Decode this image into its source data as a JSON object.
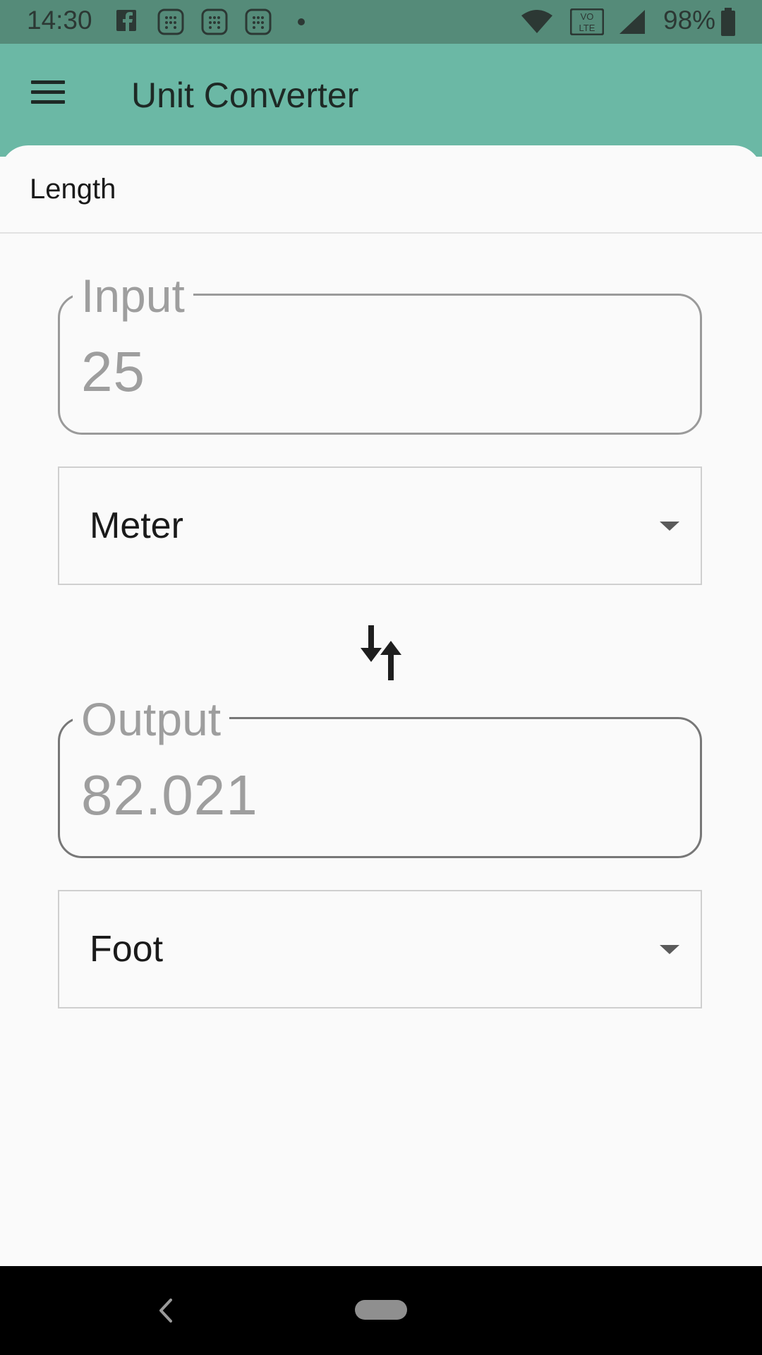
{
  "status_bar": {
    "time": "14:30",
    "battery": "98%",
    "icons": [
      "facebook-icon",
      "notification-icon",
      "notification-icon",
      "notification-icon",
      "dot-icon",
      "wifi-icon",
      "volte-icon",
      "signal-icon",
      "battery-icon"
    ],
    "volte_text": "VO\nLTE"
  },
  "app_bar": {
    "title": "Unit Converter",
    "menu_icon": "menu-icon"
  },
  "category": {
    "label": "Length"
  },
  "input": {
    "label": "Input",
    "value": "25",
    "unit": "Meter"
  },
  "output": {
    "label": "Output",
    "value": "82.021",
    "unit": "Foot"
  },
  "swap_icon": "swap-vertical-icon",
  "colors": {
    "status_bar": "#558b79",
    "app_bar": "#6bb8a5",
    "background": "#fafafa",
    "nav_bar": "#000000"
  }
}
